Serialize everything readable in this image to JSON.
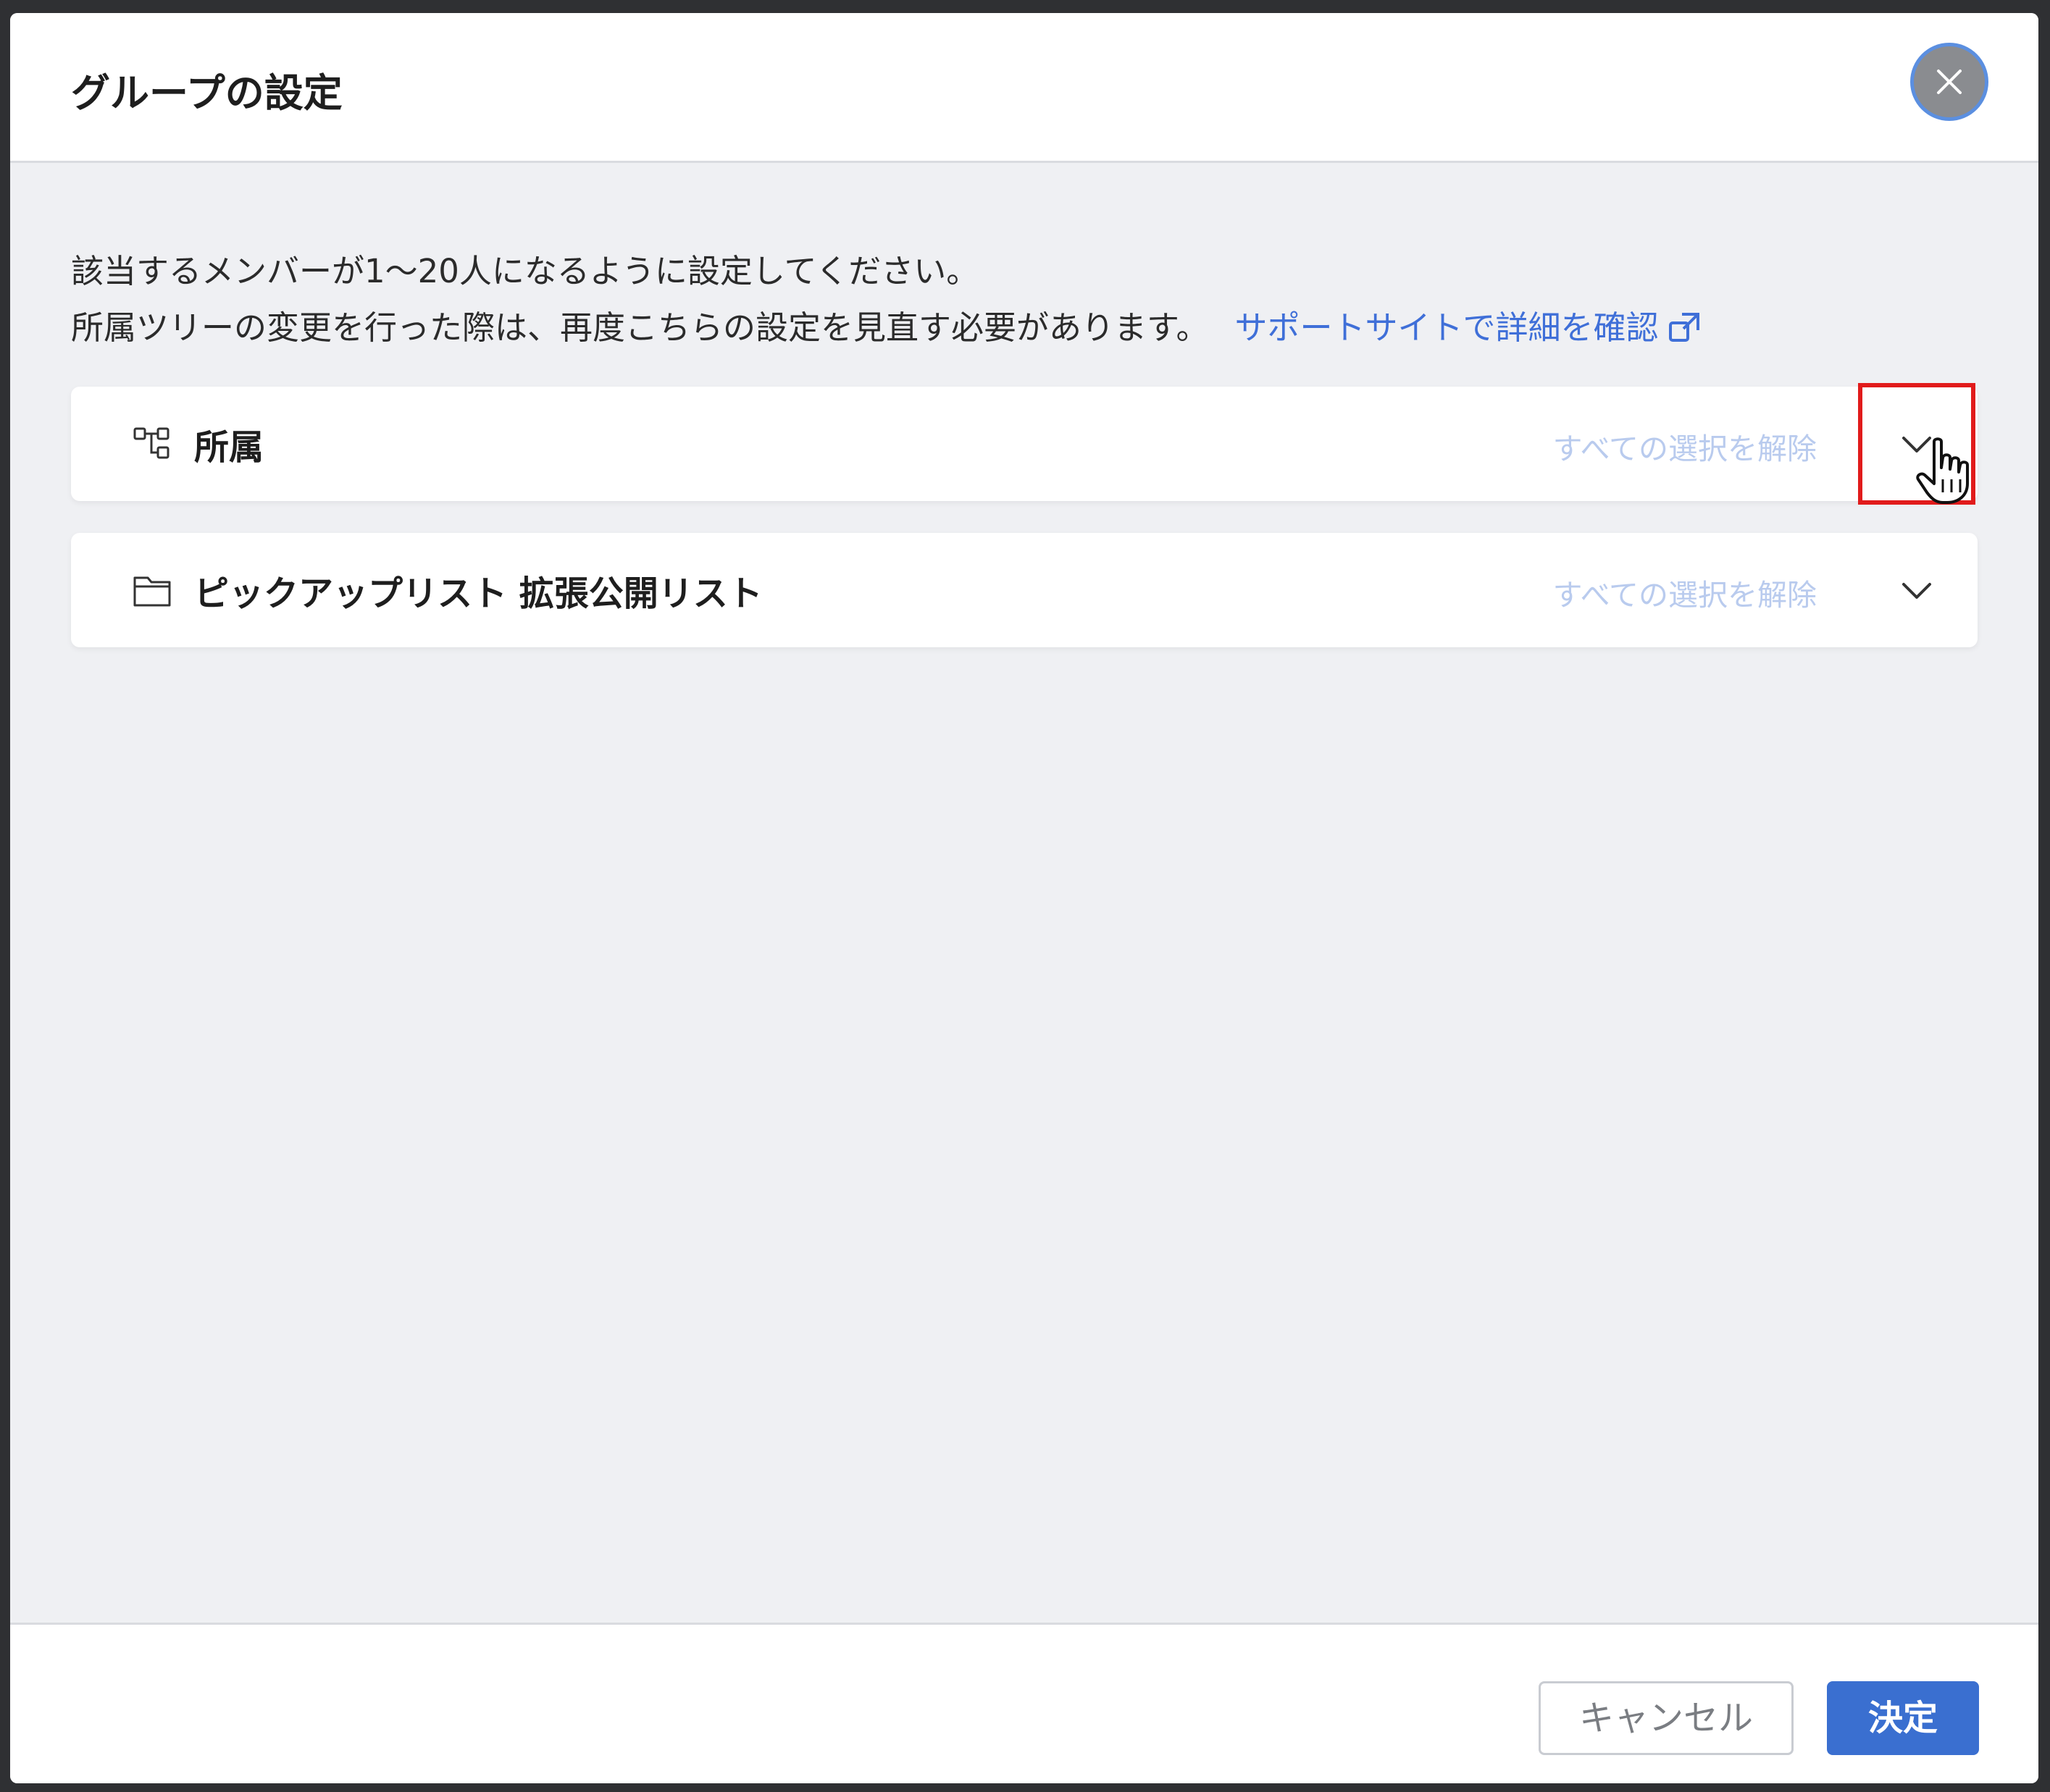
{
  "dialog": {
    "title": "グループの設定",
    "close_icon": "close-icon"
  },
  "description": {
    "line1": "該当するメンバーが1〜20人になるように設定してください。",
    "line2": "所属ツリーの変更を行った際は、再度こちらの設定を見直す必要があります。",
    "support_link": "サポートサイトで詳細を確認",
    "support_link_icon": "external-link-icon",
    "link_color": "#3f6fd8"
  },
  "sections": [
    {
      "title": "所属",
      "icon": "tree-structure-icon",
      "clear_label": "すべての選択を解除",
      "expanded": false
    },
    {
      "title": "ピックアップリスト 拡張公開リスト",
      "icon": "folder-icon",
      "clear_label": "すべての選択を解除",
      "expanded": false
    }
  ],
  "footer": {
    "cancel_label": "キャンセル",
    "confirm_label": "決定",
    "confirm_color": "#3a6fd0"
  },
  "annotation": {
    "highlight_color": "#e11b1b",
    "cursor_icon": "hand-pointer-icon"
  }
}
